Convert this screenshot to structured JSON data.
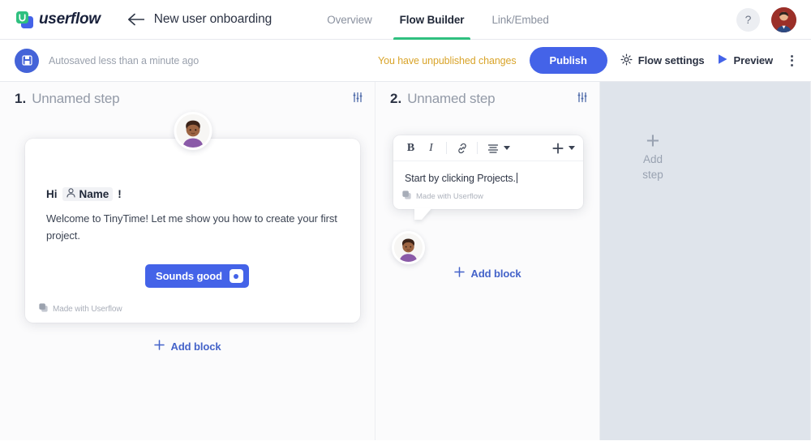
{
  "header": {
    "logo_text": "userflow",
    "logo_icon": "userflow-logo-icon",
    "back_icon": "arrow-left-icon",
    "flow_title": "New user onboarding",
    "tabs": [
      {
        "label": "Overview",
        "active": false
      },
      {
        "label": "Flow Builder",
        "active": true
      },
      {
        "label": "Link/Embed",
        "active": false
      }
    ],
    "help_label": "?",
    "avatar_name": "user-avatar"
  },
  "toolbar": {
    "save_icon": "save-icon",
    "autosave_text": "Autosaved less than a minute ago",
    "unpublished_text": "You have unpublished changes",
    "publish_label": "Publish",
    "flow_settings_label": "Flow settings",
    "flow_settings_icon": "gear-icon",
    "preview_label": "Preview",
    "preview_icon": "play-icon",
    "more_icon": "kebab-menu-icon"
  },
  "steps": [
    {
      "number": "1.",
      "name": "Unnamed step",
      "settings_icon": "sliders-icon",
      "add_block_label": "Add block",
      "card": {
        "avatar": "persona-avatar",
        "greeting_prefix": "Hi",
        "greeting_variable": "Name",
        "greeting_variable_icon": "person-icon",
        "greeting_suffix": "!",
        "body": "Welcome to TinyTime! Let me show you how to create your first project.",
        "button_label": "Sounds good",
        "branding": "Made with Userflow",
        "branding_icon": "userflow-mini-icon"
      }
    },
    {
      "number": "2.",
      "name": "Unnamed step",
      "settings_icon": "sliders-icon",
      "add_block_label": "Add block",
      "incoming_arrow_icon": "arrow-right-icon",
      "tooltip": {
        "format_buttons": [
          {
            "label": "B",
            "name": "bold-button"
          },
          {
            "label": "I",
            "name": "italic-button"
          },
          {
            "label": "link",
            "name": "link-button"
          },
          {
            "label": "align",
            "name": "align-button"
          },
          {
            "label": "plus",
            "name": "insert-button"
          }
        ],
        "text": "Start by clicking Projects.",
        "branding": "Made with Userflow",
        "branding_icon": "userflow-mini-icon",
        "avatar": "persona-avatar"
      }
    }
  ],
  "add_step": {
    "plus": "+",
    "line1": "Add",
    "line2": "step"
  },
  "colors": {
    "brand_blue": "#4463e8",
    "accent_green": "#2fc07f",
    "warning_yellow": "#d9a42a",
    "canvas_empty": "#dfe4eb"
  }
}
